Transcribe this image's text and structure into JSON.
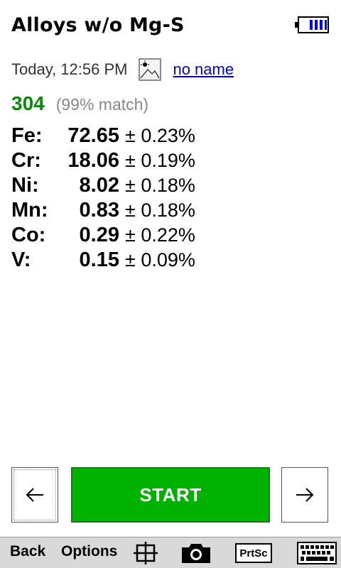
{
  "header": {
    "title": "Alloys w/o Mg-S",
    "battery_icon": "battery-full-icon"
  },
  "meta": {
    "timestamp": "Today, 12:56 PM",
    "photo_icon": "image-thumbnail-icon",
    "name_link": "no name"
  },
  "result": {
    "grade": "304",
    "match": "(99% match)",
    "grade_color": "#0a8a0a"
  },
  "elements": [
    {
      "symbol": "Fe:",
      "value": "72.65",
      "error": "± 0.23%"
    },
    {
      "symbol": "Cr:",
      "value": "18.06",
      "error": "± 0.19%"
    },
    {
      "symbol": "Ni:",
      "value": "8.02",
      "error": "± 0.18%"
    },
    {
      "symbol": "Mn:",
      "value": "0.83",
      "error": "± 0.18%"
    },
    {
      "symbol": "Co:",
      "value": "0.29",
      "error": "± 0.22%"
    },
    {
      "symbol": "V:",
      "value": "0.15",
      "error": "± 0.09%"
    }
  ],
  "actions": {
    "prev_icon": "arrow-left-icon",
    "start_label": "START",
    "start_color": "#00b200",
    "next_icon": "arrow-right-icon"
  },
  "toolbar": {
    "back_label": "Back",
    "options_label": "Options",
    "crosshair_icon": "crosshair-icon",
    "camera_icon": "camera-icon",
    "prtsc_label": "PrtSc",
    "keyboard_icon": "keyboard-icon"
  }
}
